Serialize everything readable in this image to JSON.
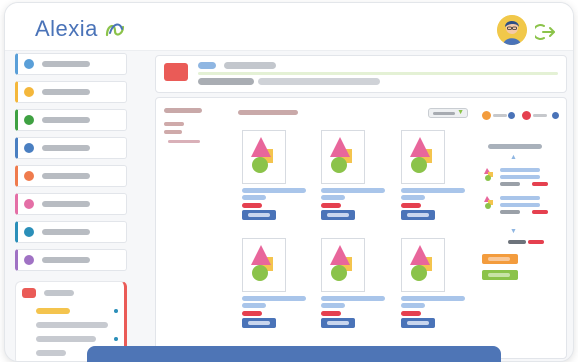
{
  "app": {
    "brand": "Alexia",
    "colors": {
      "accent": "#4a73b8",
      "red": "#ea5b57",
      "green": "#8bc34a",
      "orange": "#f39c3d",
      "pink": "#e8669b",
      "yellow": "#f4c44e"
    }
  },
  "header": {
    "avatar_icon": "user-avatar",
    "logout_icon": "logout-icon"
  },
  "sidebar": {
    "items": [
      {
        "color": "#5a9fd8"
      },
      {
        "color": "#f4b73b"
      },
      {
        "color": "#3fa142"
      },
      {
        "color": "#4a7fc1"
      },
      {
        "color": "#ef7b4d"
      },
      {
        "color": "#e46fa6"
      },
      {
        "color": "#2b8fb9"
      },
      {
        "color": "#a072c4"
      }
    ],
    "expanded": {
      "color": "#ea5b57"
    }
  },
  "main": {
    "cards": [
      {
        "id": 1
      },
      {
        "id": 2
      },
      {
        "id": 3
      },
      {
        "id": 4
      },
      {
        "id": 5
      },
      {
        "id": 6
      }
    ],
    "arrow_up": "▲",
    "arrow_down": "▼"
  }
}
